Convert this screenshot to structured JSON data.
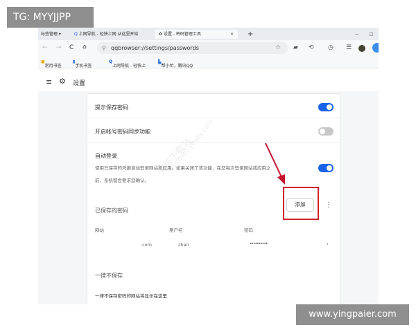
{
  "overlay_label": "TG: MYYJJPP",
  "footer_watermark": "www.yingpaier.com",
  "watermarks": [
    "天极下载站",
    "mydown.yesky.com"
  ],
  "browser": {
    "tab_group_label": "标签管理 ▾",
    "tabs": [
      {
        "label": "上网导航 - 轻快上网 从这里开始"
      },
      {
        "label": "设置 - 密码管理工具"
      }
    ],
    "new_tab": "+",
    "close_tab": "×",
    "minimize": "−",
    "maximize": "□",
    "url": "qqbrowser://settings/passwords",
    "bookmarks": [
      {
        "label": "常用书签"
      },
      {
        "label": "手机书签"
      },
      {
        "label": "上网导航 - 轻快上"
      },
      {
        "label": "帮小忙，腾讯QQ"
      }
    ]
  },
  "header": {
    "title": "设置"
  },
  "settings": {
    "offer_save": {
      "label": "提示保存密码",
      "enabled": true
    },
    "sync": {
      "label": "开启帐号密码同步功能",
      "enabled": false
    },
    "auto_login": {
      "label": "自动登录",
      "desc_line1": "使用已保存的凭据自动登录网站和应用。如果关闭了该功能，在您每次登录网站或应用之",
      "desc_line2": "前，系统都会要求您确认。",
      "enabled": true
    },
    "saved": {
      "title": "已保存的密码",
      "add_button": "添加",
      "columns": [
        "网站",
        "用户名",
        "密码"
      ],
      "rows": [
        {
          "site": ".com",
          "username": "zhan",
          "password": "••••••••••"
        }
      ]
    },
    "never_saved": {
      "title": "一律不保存",
      "empty_text": "一律不保存密码的网站将显示在这里"
    }
  },
  "colors": {
    "accent": "#1a62e8",
    "highlight": "#d0202a"
  }
}
